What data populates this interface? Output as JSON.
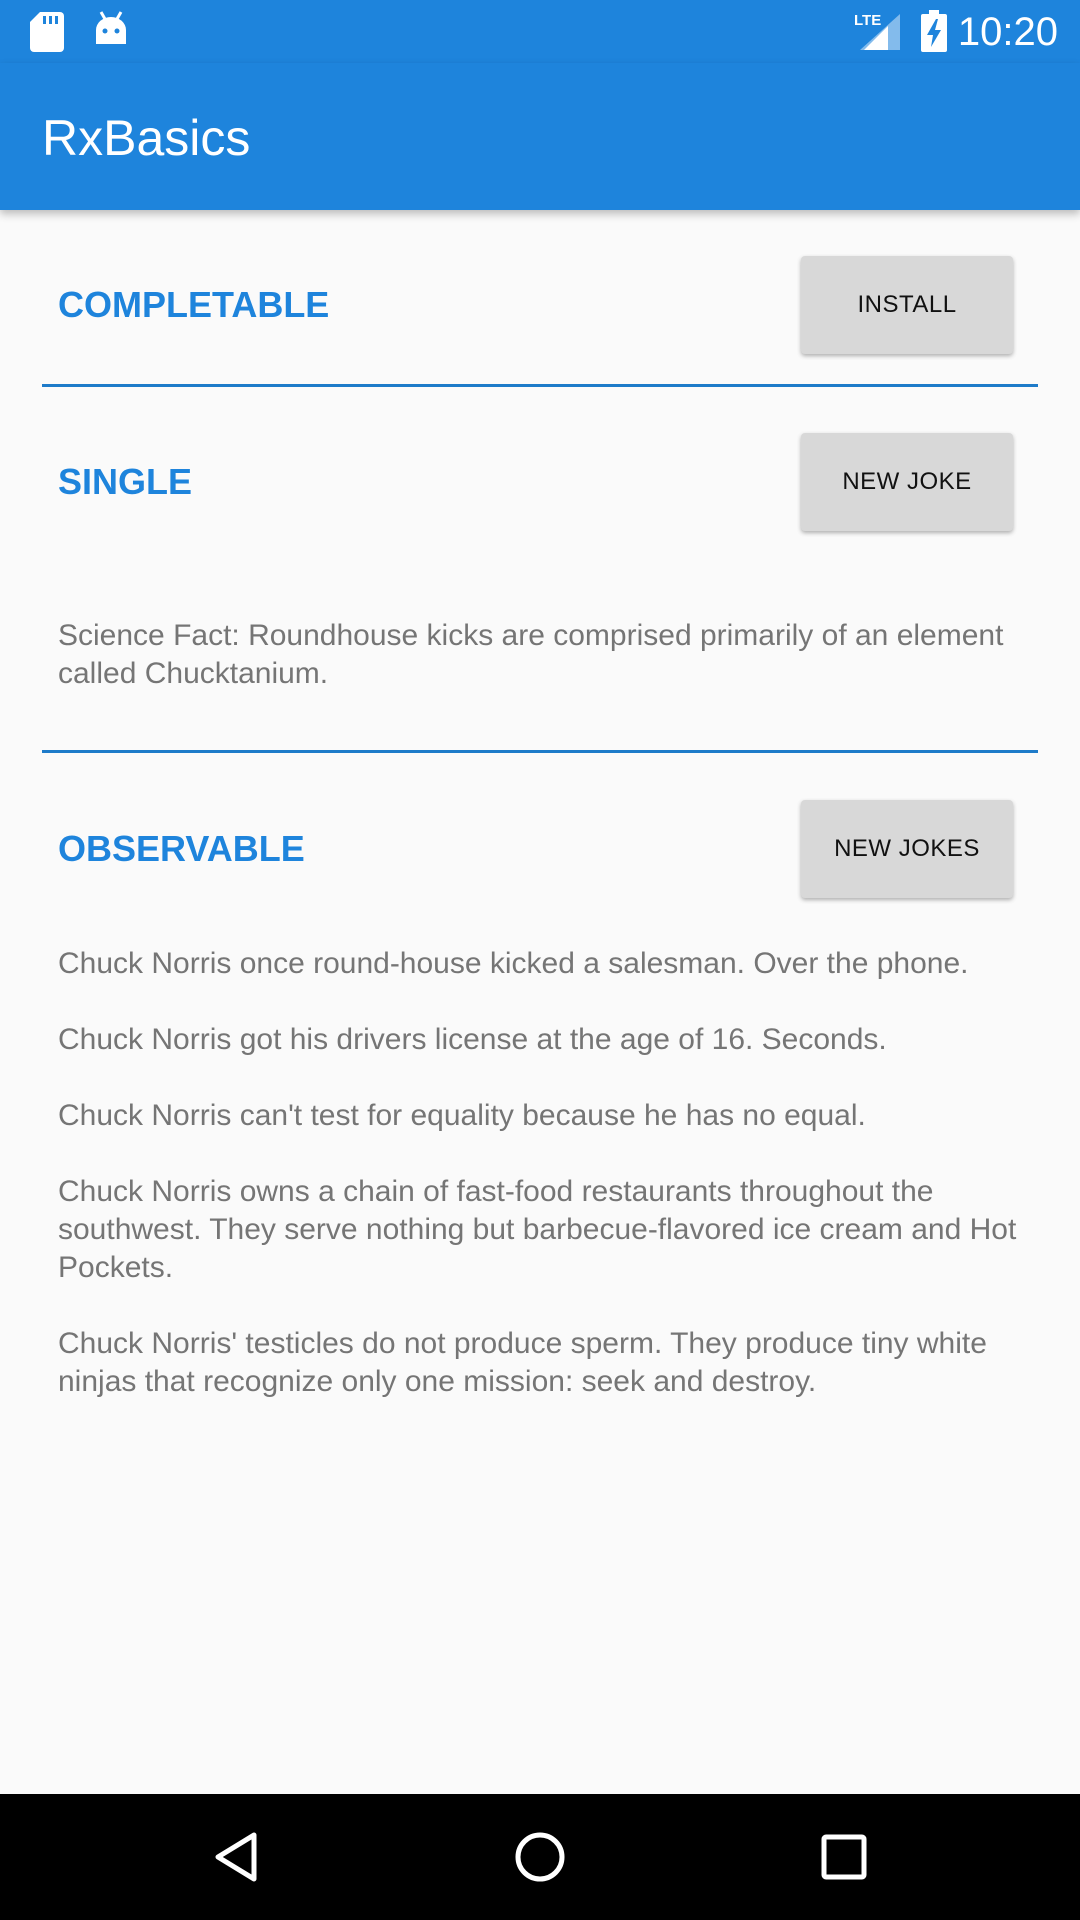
{
  "status_bar": {
    "time": "10:20",
    "network_label": "LTE",
    "icons": [
      "sd-card-icon",
      "android-icon",
      "lte-signal-icon",
      "battery-charging-icon"
    ]
  },
  "app_bar": {
    "title": "RxBasics"
  },
  "sections": {
    "completable": {
      "title": "COMPLETABLE",
      "button_label": "INSTALL"
    },
    "single": {
      "title": "SINGLE",
      "button_label": "NEW JOKE",
      "result": "Science Fact: Roundhouse kicks are comprised primarily of an element called Chucktanium."
    },
    "observable": {
      "title": "OBSERVABLE",
      "button_label": "NEW JOKES",
      "jokes": [
        "Chuck Norris once round-house kicked a salesman. Over the phone.",
        "Chuck Norris got his drivers license at the age of 16. Seconds.",
        "Chuck Norris can't test for equality because he has no equal.",
        "Chuck Norris owns a chain of fast-food restaurants throughout the southwest. They serve nothing but barbecue-flavored ice cream and Hot Pockets.",
        "Chuck Norris' testicles do not produce sperm. They produce tiny white ninjas that recognize only one mission: seek and destroy."
      ]
    }
  },
  "nav_bar": {
    "buttons": [
      "back-icon",
      "home-icon",
      "recents-icon"
    ]
  },
  "colors": {
    "primary": "#1e84dc",
    "accent_text": "#1e84dc",
    "button_bg": "#d8d8d8",
    "body_text": "#757575",
    "background": "#fafafa",
    "nav_bar": "#000000"
  }
}
